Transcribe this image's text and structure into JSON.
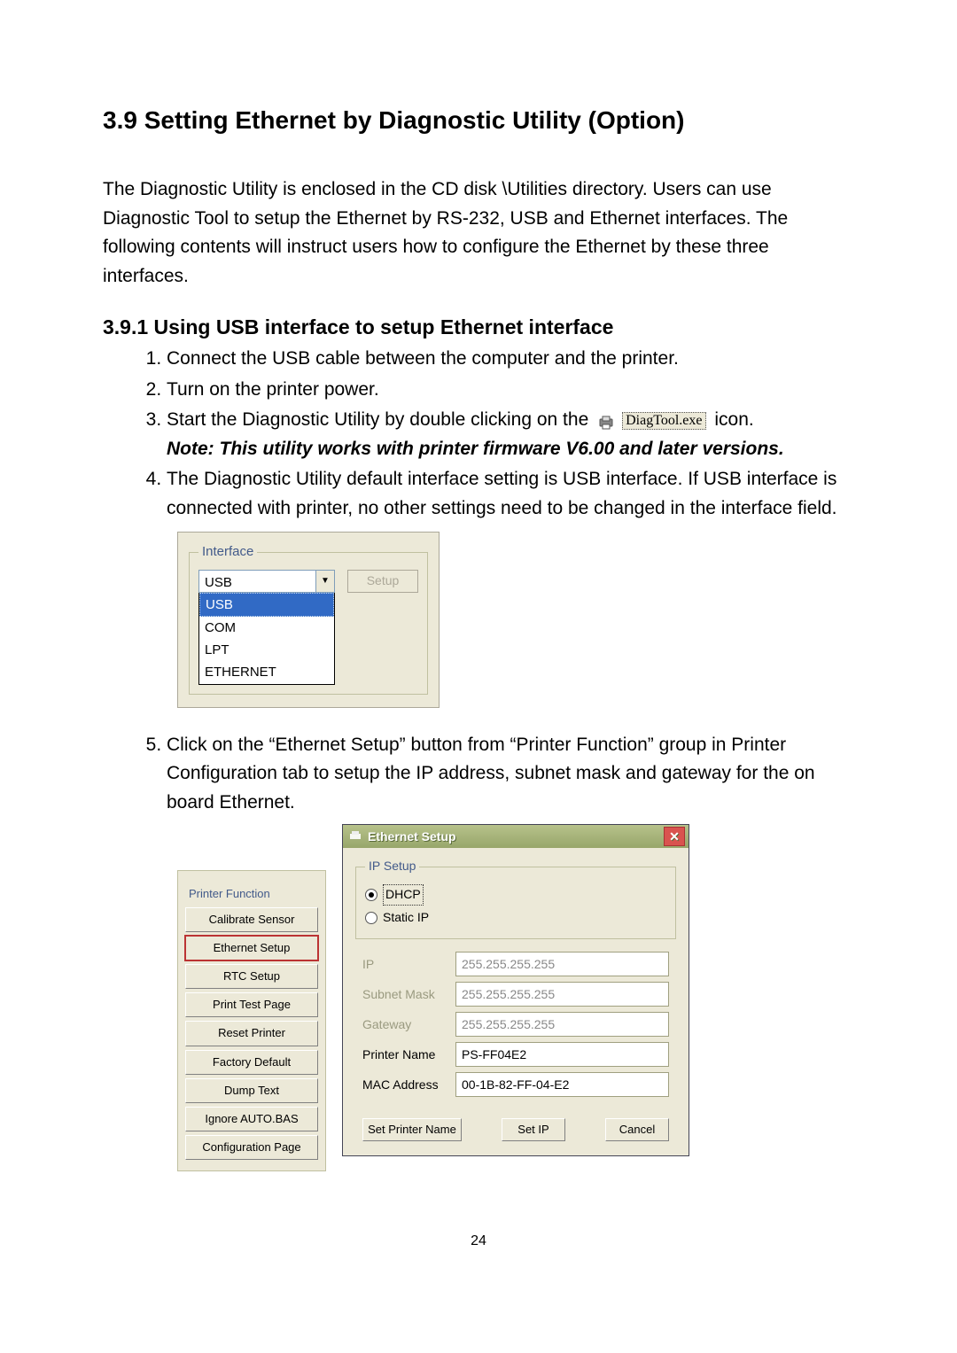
{
  "section": {
    "title": "3.9 Setting Ethernet by Diagnostic Utility (Option)",
    "intro": "The Diagnostic Utility is enclosed in the CD disk \\Utilities directory. Users can use Diagnostic Tool to setup the Ethernet by RS-232, USB and Ethernet interfaces. The following contents will instruct users how to configure the Ethernet by these three interfaces."
  },
  "subsection": {
    "title": "3.9.1 Using USB interface to setup Ethernet interface",
    "step1": "Connect the USB cable between the computer and the printer.",
    "step2": "Turn on the printer power.",
    "step3_pre": "Start the Diagnostic Utility by double clicking on the",
    "step3_iconlabel": "DiagTool.exe",
    "step3_post": "icon.",
    "step3_note": "Note: This utility works with printer firmware V6.00 and later versions.",
    "step4": "The Diagnostic Utility default interface setting is USB interface. If USB interface is connected with printer, no other settings need to be changed in the interface field.",
    "step5": "Click on the “Ethernet Setup” button from “Printer Function” group in Printer Configuration tab to setup the IP address, subnet mask and gateway for the on board Ethernet."
  },
  "interfacePanel": {
    "legend": "Interface",
    "selected": "USB",
    "options": [
      "USB",
      "COM",
      "LPT",
      "ETHERNET"
    ],
    "setupBtn": "Setup"
  },
  "printerFunction": {
    "legend": "Printer Function",
    "buttons": [
      "Calibrate Sensor",
      "Ethernet Setup",
      "RTC Setup",
      "Print Test Page",
      "Reset Printer",
      "Factory Default",
      "Dump Text",
      "Ignore AUTO.BAS",
      "Configuration Page"
    ],
    "highlightIndex": 1
  },
  "ethernetDialog": {
    "title": "Ethernet Setup",
    "ipSetupLegend": "IP Setup",
    "dhcpLabel": "DHCP",
    "staticLabel": "Static IP",
    "fields": {
      "ip": {
        "label": "IP",
        "value": "255.255.255.255",
        "disabled": true
      },
      "subnet": {
        "label": "Subnet Mask",
        "value": "255.255.255.255",
        "disabled": true
      },
      "gateway": {
        "label": "Gateway",
        "value": "255.255.255.255",
        "disabled": true
      },
      "printerName": {
        "label": "Printer Name",
        "value": "PS-FF04E2",
        "disabled": false
      },
      "mac": {
        "label": "MAC Address",
        "value": "00-1B-82-FF-04-E2",
        "disabled": false
      }
    },
    "buttons": {
      "setPrinterName": "Set Printer Name",
      "setIP": "Set IP",
      "cancel": "Cancel"
    }
  },
  "pageNumber": "24"
}
